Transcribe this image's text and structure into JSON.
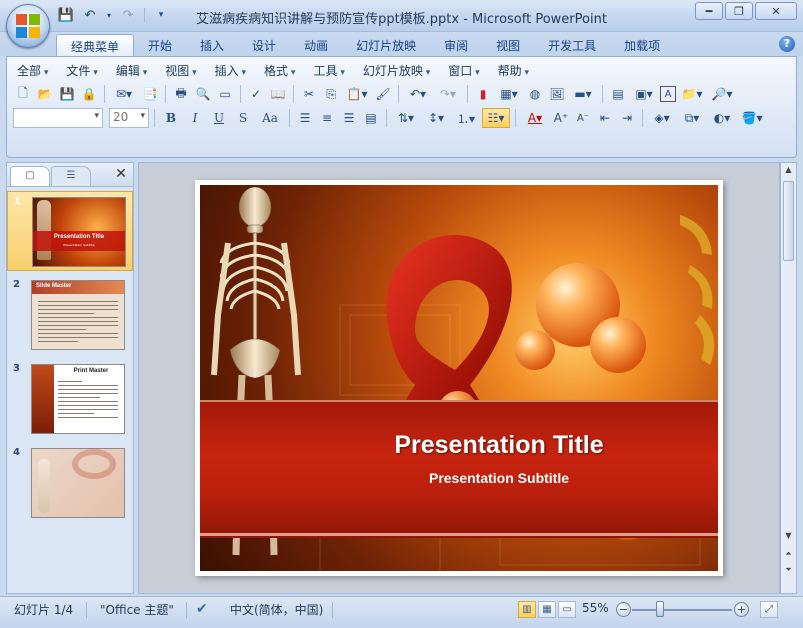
{
  "titlebar": {
    "title": "艾滋病疾病知识讲解与预防宣传ppt模板.pptx - Microsoft PowerPoint",
    "qat_icons": [
      "save-icon",
      "undo-icon",
      "redo-icon",
      "customize-qat-icon"
    ],
    "window_controls": [
      "minimize",
      "maximize",
      "close"
    ]
  },
  "ribbon": {
    "tabs": [
      "经典菜单",
      "开始",
      "插入",
      "设计",
      "动画",
      "幻灯片放映",
      "审阅",
      "视图",
      "开发工具",
      "加载项"
    ],
    "active_tab": "经典菜单",
    "menus": [
      "全部",
      "文件",
      "编辑",
      "视图",
      "插入",
      "格式",
      "工具",
      "幻灯片放映",
      "窗口",
      "帮助"
    ],
    "font_name_value": "",
    "font_size_value": "20",
    "format_buttons": [
      "B",
      "I",
      "U",
      "S",
      "Aa"
    ]
  },
  "left_pane": {
    "tab_icons": [
      "slides-tab-icon",
      "outline-tab-icon"
    ],
    "thumbnails": [
      {
        "num": "1",
        "title": "Presentation Title",
        "subtitle": "Presentation Subtitle"
      },
      {
        "num": "2",
        "title": "Slide Master"
      },
      {
        "num": "3",
        "title": "Print Master"
      },
      {
        "num": "4",
        "title": ""
      }
    ],
    "selected_index": 1
  },
  "slide": {
    "title": "Presentation Title",
    "subtitle": "Presentation Subtitle"
  },
  "status": {
    "slide_counter": "幻灯片 1/4",
    "theme": "\"Office 主题\"",
    "language": "中文(简体，中国)",
    "zoom": "55%",
    "zoom_value": 55
  }
}
